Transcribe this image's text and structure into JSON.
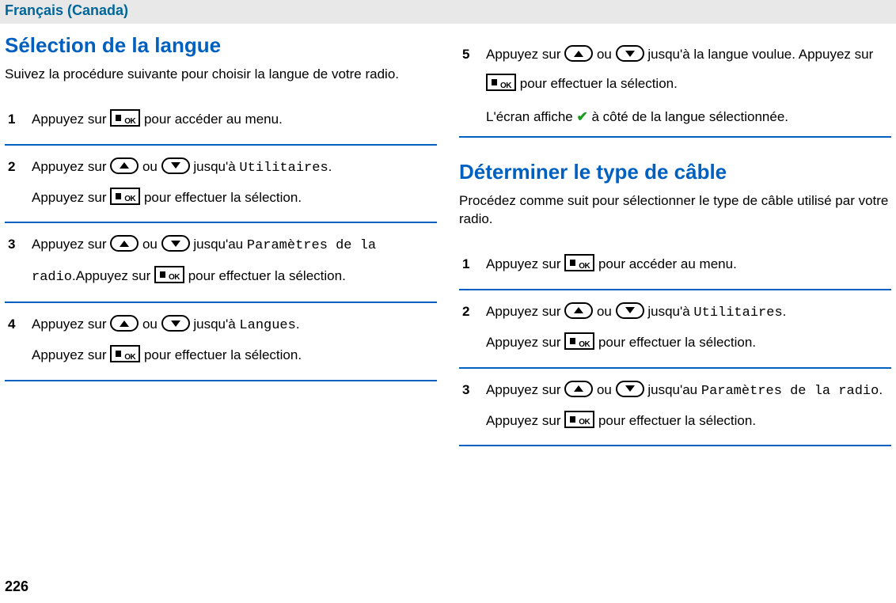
{
  "header": {
    "lang": "Français (Canada)"
  },
  "sectionA": {
    "title": "Sélection de la langue",
    "intro": "Suivez la procédure suivante pour choisir la langue de votre radio.",
    "steps": [
      {
        "num": "1",
        "p1a": "Appuyez sur ",
        "p1b": " pour accéder au menu."
      },
      {
        "num": "2",
        "p1a": "Appuyez sur ",
        "p1b": " ou ",
        "p1c": " jusqu'à ",
        "menu1": "Utilitaires",
        "p1d": ".",
        "p2a": "Appuyez sur ",
        "p2b": " pour effectuer la sélection."
      },
      {
        "num": "3",
        "p1a": "Appuyez sur ",
        "p1b": " ou ",
        "p1c": " jusqu'au ",
        "menu1": "Paramètres de la radio",
        "p1d": ".Appuyez sur ",
        "p1e": " pour effectuer la sélection."
      },
      {
        "num": "4",
        "p1a": "Appuyez sur ",
        "p1b": " ou ",
        "p1c": " jusqu'à ",
        "menu1": "Langues",
        "p1d": ".",
        "p2a": "Appuyez sur ",
        "p2b": " pour effectuer la sélection."
      },
      {
        "num": "5",
        "p1a": "Appuyez sur ",
        "p1b": " ou ",
        "p1c": " jusqu'à la langue voulue. Appuyez sur ",
        "p1d": " pour effectuer la sélection.",
        "confirmA": "L'écran affiche ",
        "confirmB": " à côté de la langue sélectionnée."
      }
    ]
  },
  "sectionB": {
    "title": "Déterminer le type de câble",
    "intro": "Procédez comme suit pour sélectionner le type de câble utilisé par votre radio.",
    "steps": [
      {
        "num": "1",
        "p1a": "Appuyez sur ",
        "p1b": " pour accéder au menu."
      },
      {
        "num": "2",
        "p1a": "Appuyez sur ",
        "p1b": " ou ",
        "p1c": " jusqu'à ",
        "menu1": "Utilitaires",
        "p1d": ".",
        "p2a": "Appuyez sur ",
        "p2b": " pour effectuer la sélection."
      },
      {
        "num": "3",
        "p1a": "Appuyez sur ",
        "p1b": " ou ",
        "p1c": " jusqu'au ",
        "menu1": "Paramètres de la radio",
        "p1d": ". Appuyez sur ",
        "p1e": " pour effectuer la sélection."
      }
    ]
  },
  "pageNumber": "226"
}
